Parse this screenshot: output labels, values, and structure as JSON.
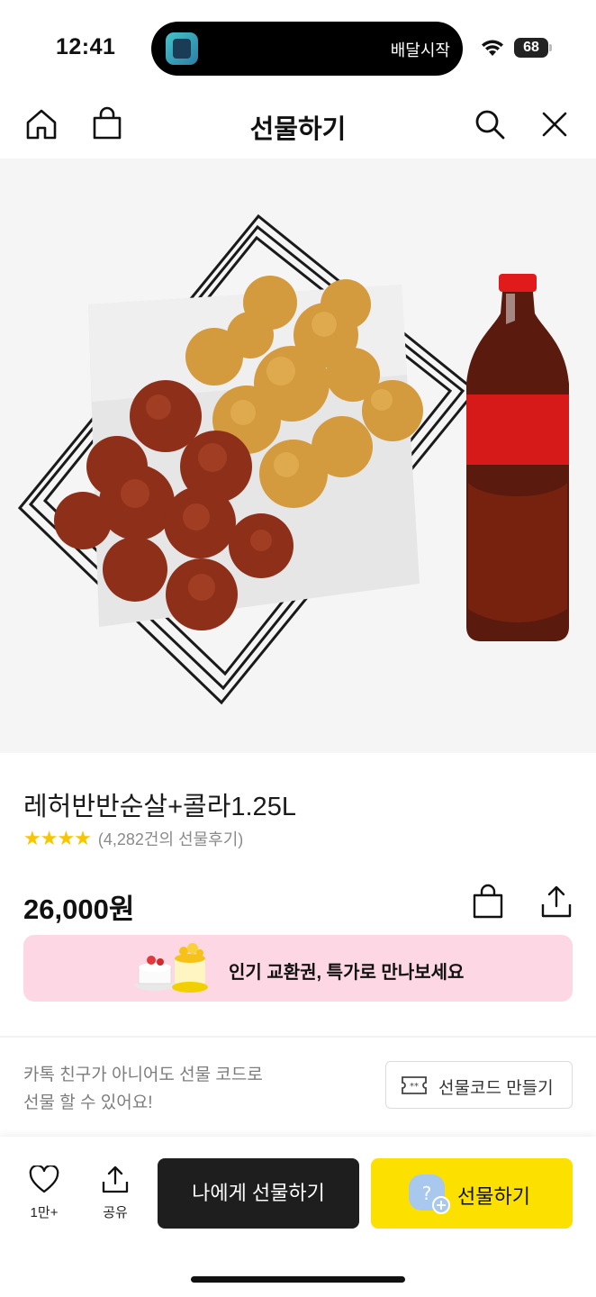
{
  "status_bar": {
    "time": "12:41",
    "live_activity_text": "배달시작",
    "battery_level": "68"
  },
  "header": {
    "title": "선물하기",
    "icons": [
      "home-icon",
      "bag-icon",
      "search-icon",
      "close-icon"
    ]
  },
  "product": {
    "name": "레허반반순살+콜라1.25L",
    "stars": "★★★★",
    "review_count": "(4,282건의 선물후기)",
    "price": "26,000원"
  },
  "promo_banner": {
    "text": "인기 교환권, 특가로 만나보세요",
    "background": "#fdd7e4"
  },
  "gift_code": {
    "description_line1": "카톡 친구가 아니어도 선물 코드로",
    "description_line2": "선물 할 수 있어요!",
    "button_label": "선물코드 만들기"
  },
  "bottom_bar": {
    "like_count": "1만+",
    "share_label": "공유",
    "gift_self_label": "나에게 선물하기",
    "gift_label": "선물하기",
    "accent": "#fce100"
  }
}
